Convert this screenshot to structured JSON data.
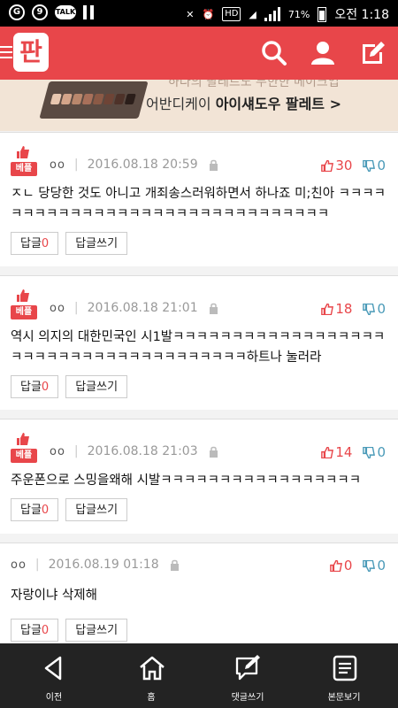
{
  "status_bar": {
    "battery": "71%",
    "time": "오전 1:18",
    "badge_9": "9",
    "talk": "TALK",
    "hd": "HD"
  },
  "header": {
    "logo": "판"
  },
  "banner": {
    "partial_text": "하다의 팔레트도 무한한 메이크업",
    "text_prefix": "어반디케이 ",
    "text_bold": "아이섀도우 팔레트 >"
  },
  "comments": [
    {
      "best": true,
      "best_label": "베플",
      "user": "oo",
      "date": "2016.08.18 20:59",
      "up": "30",
      "down": "0",
      "text": "ㅈㄴ 당당한 것도 아니고 개죄송스러워하면서 하나죠 미;친아 ㅋㅋㅋㅋㅋㅋㅋㅋㅋㅋㅋㅋㅋㅋㅋㅋㅋㅋㅋㅋㅋㅋㅋㅋㅋㅋㅋㅋㅋㅋㅋ",
      "reply_label": "답글",
      "reply_count": "0",
      "write_reply": "답글쓰기"
    },
    {
      "best": true,
      "best_label": "베플",
      "user": "oo",
      "date": "2016.08.18 21:01",
      "up": "18",
      "down": "0",
      "text": "역시 의지의 대한민국인 시1발ㅋㅋㅋㅋㅋㅋㅋㅋㅋㅋㅋㅋㅋㅋㅋㅋㅋㅋㅋㅋㅋㅋㅋㅋㅋㅋㅋㅋㅋㅋㅋㅋㅋㅋㅋㅋㅋㅋ하트나 눌러라",
      "reply_label": "답글",
      "reply_count": "0",
      "write_reply": "답글쓰기"
    },
    {
      "best": true,
      "best_label": "베플",
      "user": "oo",
      "date": "2016.08.18 21:03",
      "up": "14",
      "down": "0",
      "text": "주운폰으로 스밍을왜해 시발ㅋㅋㅋㅋㅋㅋㅋㅋㅋㅋㅋㅋㅋㅋㅋㅋㅋ",
      "reply_label": "답글",
      "reply_count": "0",
      "write_reply": "답글쓰기"
    },
    {
      "best": false,
      "user": "oo",
      "date": "2016.08.19 01:18",
      "up": "0",
      "down": "0",
      "text": "자랑이냐 삭제해",
      "reply_label": "답글",
      "reply_count": "0",
      "write_reply": "답글쓰기"
    }
  ],
  "bottom_nav": [
    {
      "label": "이전",
      "icon": "back-arrow-icon"
    },
    {
      "label": "홈",
      "icon": "home-icon"
    },
    {
      "label": "댓글쓰기",
      "icon": "write-comment-icon"
    },
    {
      "label": "본문보기",
      "icon": "document-icon"
    }
  ],
  "colors": {
    "brand": "#e8464a",
    "down_vote": "#4a9ab8",
    "nav_bg": "#232323"
  }
}
